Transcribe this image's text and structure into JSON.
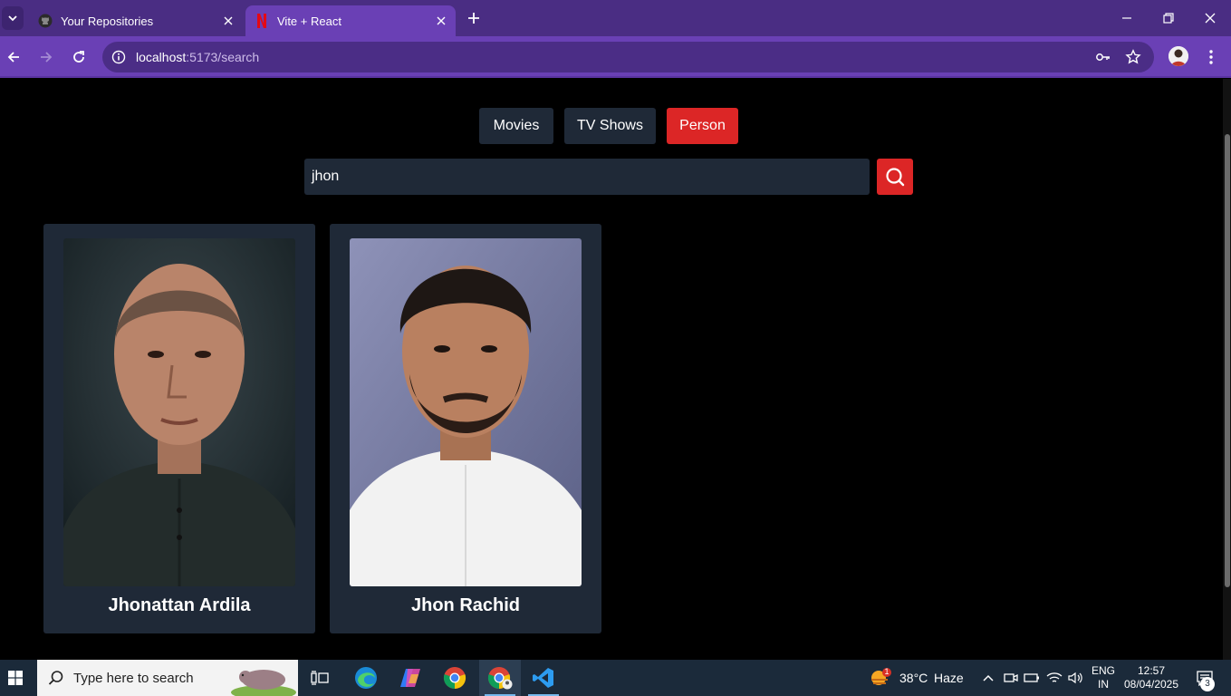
{
  "browser": {
    "tabs": [
      {
        "title": "Your Repositories",
        "icon": "github-icon"
      },
      {
        "title": "Vite + React",
        "icon": "netflix-icon",
        "active": true
      }
    ],
    "url_host": "localhost",
    "url_path": ":5173/search"
  },
  "page": {
    "type_buttons": [
      {
        "label": "Movies",
        "active": false
      },
      {
        "label": "TV Shows",
        "active": false
      },
      {
        "label": "Person",
        "active": true
      }
    ],
    "search_value": "jhon",
    "results": [
      {
        "name": "Jhonattan Ardila"
      },
      {
        "name": "Jhon Rachid"
      }
    ],
    "colors": {
      "accent": "#dc2626",
      "panel": "#1f2937",
      "background": "#000000"
    }
  },
  "taskbar": {
    "search_placeholder": "Type here to search",
    "weather": {
      "temp": "38°C",
      "condition": "Haze",
      "badge": "1"
    },
    "lang_line1": "ENG",
    "lang_line2": "IN",
    "time": "12:57",
    "date": "08/04/2025",
    "notifications": "3"
  }
}
